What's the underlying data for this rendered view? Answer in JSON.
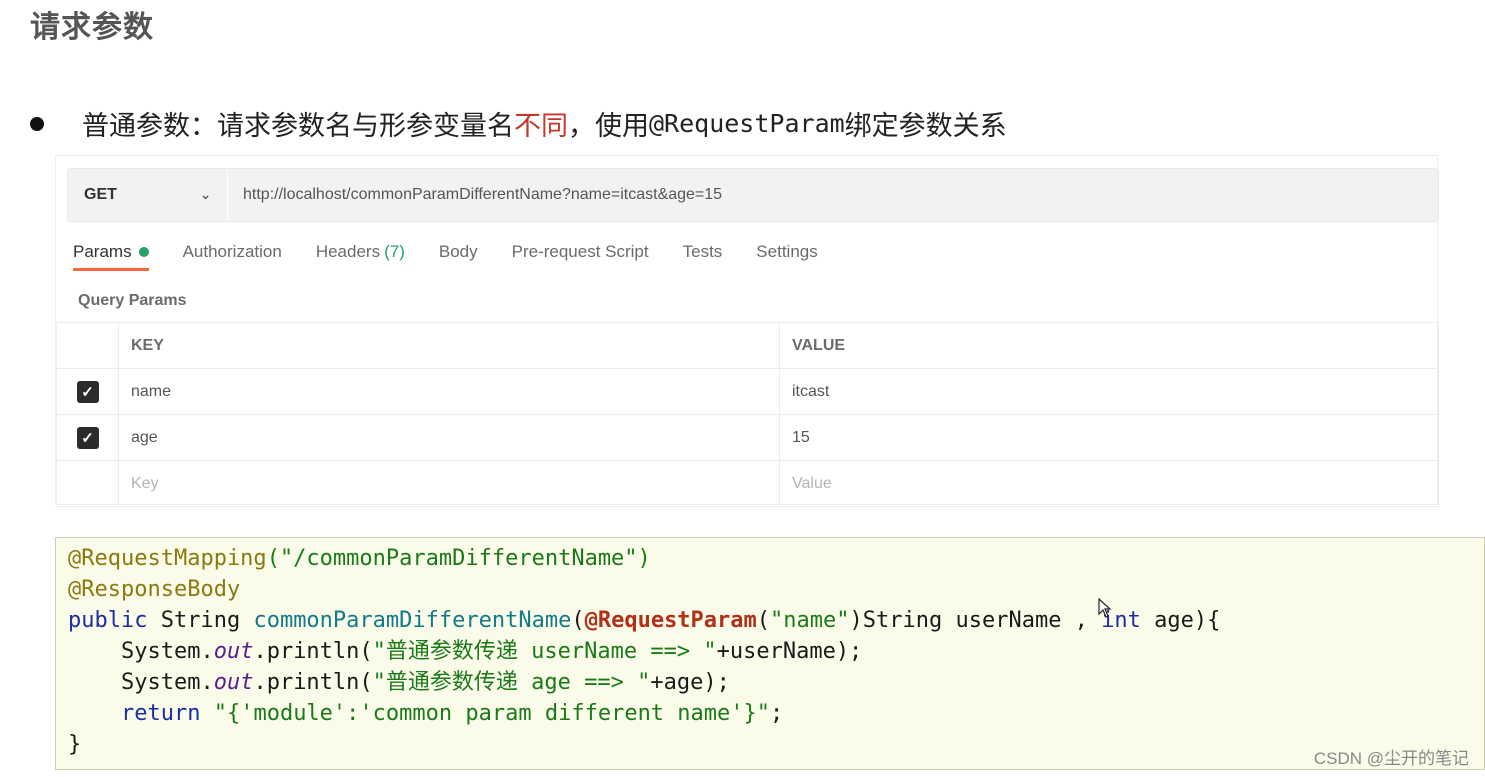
{
  "page_title": "请求参数",
  "bullet": {
    "prefix": "普通参数：请求参数名与形参变量名",
    "highlight": "不同",
    "middle": "，使用",
    "annotation": "@RequestParam",
    "suffix": "绑定参数关系"
  },
  "postman": {
    "method": "GET",
    "url": "http://localhost/commonParamDifferentName?name=itcast&age=15",
    "tabs": [
      {
        "label": "Params"
      },
      {
        "label": "Authorization"
      },
      {
        "label": "Headers",
        "count": "(7)"
      },
      {
        "label": "Body"
      },
      {
        "label": "Pre-request Script"
      },
      {
        "label": "Tests"
      },
      {
        "label": "Settings"
      }
    ],
    "query_params_label": "Query Params",
    "table": {
      "key_header": "KEY",
      "value_header": "VALUE",
      "rows": [
        {
          "key": "name",
          "value": "itcast",
          "checked": true
        },
        {
          "key": "age",
          "value": "15",
          "checked": true
        }
      ],
      "key_placeholder": "Key",
      "value_placeholder": "Value"
    }
  },
  "code": {
    "line1_ann": "@RequestMapping",
    "line1_rest": "(\"/commonParamDifferentName\")",
    "line2_ann": "@ResponseBody",
    "line3_public": "public",
    "line3_type": " String ",
    "line3_method": "commonParamDifferentName",
    "line3_paren": "(",
    "line3_ann": "@RequestParam",
    "line3_arg_open": "(",
    "line3_arg_str": "\"name\"",
    "line3_arg_rest": ")String userName , ",
    "line3_int": "int",
    "line3_end": " age){",
    "line4_a": "    System.",
    "line4_out": "out",
    "line4_b": ".println(",
    "line4_str": "\"普通参数传递 userName ==> \"",
    "line4_c": "+userName);",
    "line5_a": "    System.",
    "line5_out": "out",
    "line5_b": ".println(",
    "line5_str": "\"普通参数传递 age ==> \"",
    "line5_c": "+age);",
    "line6_indent": "    ",
    "line6_return": "return",
    "line6_sp": " ",
    "line6_str": "\"{'module':'common param different name'}\"",
    "line6_end": ";",
    "line7": "}"
  },
  "watermark": "CSDN @尘开的笔记"
}
